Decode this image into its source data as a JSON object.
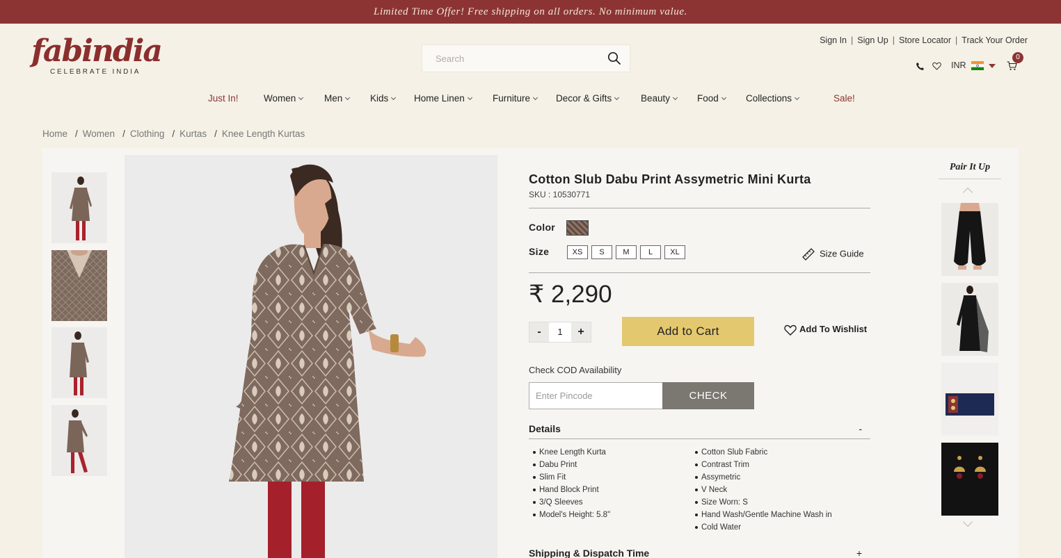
{
  "promo": {
    "text": "Limited Time Offer! Free shipping on all orders. No minimum value."
  },
  "logo": {
    "wordmark": "fabindia",
    "tagline": "CELEBRATE INDIA"
  },
  "search": {
    "placeholder": "Search"
  },
  "header_links": {
    "sign_in": "Sign In",
    "sign_up": "Sign Up",
    "store_locator": "Store Locator",
    "track_order": "Track Your Order"
  },
  "header_icons": {
    "currency": "INR",
    "cart_count": "0",
    "phone_icon": "phone-icon",
    "wishlist_icon": "heart-icon",
    "flag_icon": "india-flag-icon",
    "cart_icon": "cart-icon"
  },
  "nav": {
    "items": [
      "Just In!",
      "Women",
      "Men",
      "Kids",
      "Home Linen",
      "Furniture",
      "Decor & Gifts",
      "Beauty",
      "Food",
      "Collections",
      "Sale!"
    ]
  },
  "breadcrumb": [
    "Home",
    "Women",
    "Clothing",
    "Kurtas",
    "Knee Length Kurtas"
  ],
  "product": {
    "title": "Cotton Slub Dabu Print Assymetric Mini Kurta",
    "sku": "SKU : 10530771",
    "color_label": "Color",
    "size_label": "Size",
    "sizes": [
      "XS",
      "S",
      "M",
      "L",
      "XL"
    ],
    "size_guide": "Size Guide",
    "price": "₹ 2,290",
    "quantity": "1",
    "qty_minus": "-",
    "qty_plus": "+",
    "add_to_cart": "Add to Cart",
    "add_to_wishlist": "Add To Wishlist",
    "cod_label": "Check COD Availability",
    "pincode_placeholder": "Enter Pincode",
    "check_button": "CHECK",
    "details_heading": "Details",
    "details_toggle": "-",
    "details_left": [
      "Knee Length Kurta",
      "Dabu Print",
      "Slim Fit",
      "Hand Block Print",
      "3/Q Sleeves",
      "Model's Height: 5.8\""
    ],
    "details_right": [
      "Cotton Slub Fabric",
      "Contrast Trim",
      "Assymetric",
      "V Neck",
      "Size Worn: S",
      "Hand Wash/Gentle Machine Wash in",
      "Cold Water"
    ],
    "shipping_heading": "Shipping & Dispatch Time",
    "shipping_toggle": "+"
  },
  "pair_it_up": {
    "heading": "Pair It Up"
  },
  "colors": {
    "brand": "#8c3434",
    "cart_button": "#e3c86f",
    "check_button": "#7b7771",
    "background": "#f5f1e6"
  }
}
